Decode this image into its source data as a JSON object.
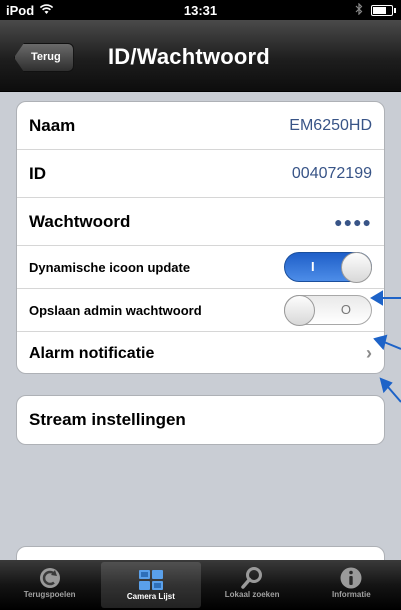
{
  "status_bar": {
    "carrier": "iPod",
    "time": "13:31"
  },
  "nav_bar": {
    "back_label": "Terug",
    "title": "ID/Wachtwoord"
  },
  "settings": {
    "rows": [
      {
        "label": "Naam",
        "value": "EM6250HD"
      },
      {
        "label": "ID",
        "value": "004072199"
      },
      {
        "label": "Wachtwoord",
        "value": "●●●●"
      },
      {
        "label": "Dynamische icoon update",
        "toggle": "on",
        "glyph": "I"
      },
      {
        "label": "Opslaan admin wachtwoord",
        "toggle": "off",
        "glyph": "O"
      },
      {
        "label": "Alarm notificatie",
        "chevron": "›"
      }
    ]
  },
  "stream": {
    "label": "Stream instellingen"
  },
  "tabs": [
    {
      "label": "Terugspoelen",
      "icon": "rewind-icon"
    },
    {
      "label": "Camera Lijst",
      "icon": "camera-list-icon",
      "active": true
    },
    {
      "label": "Lokaal zoeken",
      "icon": "search-icon"
    },
    {
      "label": "Informatie",
      "icon": "info-icon"
    }
  ],
  "colors": {
    "accent": "#385487",
    "toggle_on": "#2f72d8",
    "annotation": "#1d63c8",
    "background": "#c9cdd4"
  }
}
